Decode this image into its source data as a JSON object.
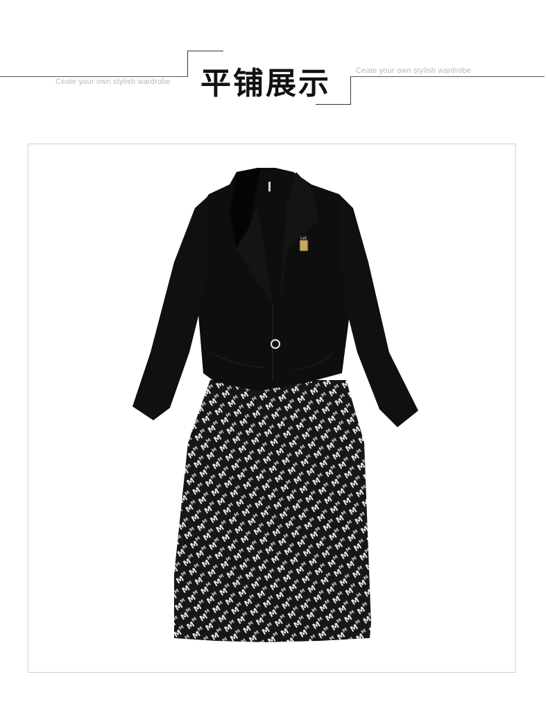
{
  "header": {
    "title": "平铺展示",
    "tagline_left": "Ceate your own stylish wardrobe",
    "tagline_right": "Ceate your own stylish wardrobe"
  },
  "product": {
    "icon": "garment-flat-lay-image",
    "colors": {
      "jacket": "#0d0d0d",
      "print_dark": "#1a1a1a",
      "print_light": "#f2f2f2"
    }
  }
}
